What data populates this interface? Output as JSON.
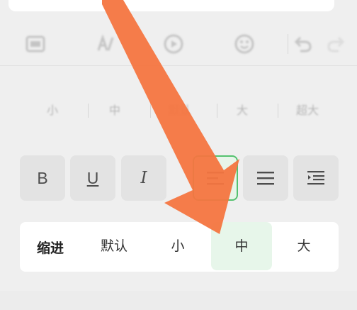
{
  "toolbar": {
    "icons": [
      "image-icon",
      "text-style-icon",
      "play-icon",
      "emoji-icon",
      "undo-icon",
      "redo-icon"
    ]
  },
  "font_size": {
    "options": [
      "小",
      "中",
      "默认",
      "大",
      "超大"
    ]
  },
  "format": {
    "bold_label": "B",
    "underline_label": "U",
    "italic_label": "I"
  },
  "indent": {
    "title": "缩进",
    "options": [
      "默认",
      "小",
      "中",
      "大"
    ],
    "selected": "中"
  },
  "colors": {
    "accent_green": "#55c26f",
    "selected_bg": "#e7f6ea",
    "arrow": "#f47540"
  }
}
